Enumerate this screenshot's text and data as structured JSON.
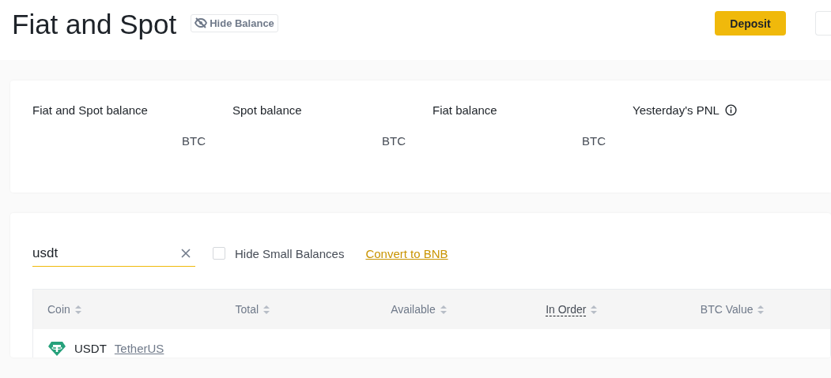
{
  "title": "Fiat and Spot",
  "hide_balance_button": "Hide Balance",
  "deposit_button": "Deposit",
  "balances": [
    {
      "label": "Fiat and Spot balance",
      "unit": "BTC",
      "info": false
    },
    {
      "label": "Spot balance",
      "unit": "BTC",
      "info": false
    },
    {
      "label": "Fiat balance",
      "unit": "BTC",
      "info": false
    },
    {
      "label": "Yesterday's PNL",
      "info": true
    }
  ],
  "search": {
    "value": "usdt"
  },
  "hide_small_balances": {
    "label": "Hide Small Balances",
    "checked": false
  },
  "convert_link": "Convert to BNB",
  "table": {
    "columns": [
      {
        "label": "Coin",
        "tooltip": false
      },
      {
        "label": "Total",
        "tooltip": false
      },
      {
        "label": "Available",
        "tooltip": false
      },
      {
        "label": "In Order",
        "tooltip": true
      },
      {
        "label": "BTC Value",
        "tooltip": false
      }
    ],
    "rows": [
      {
        "coin": "USDT",
        "name": "TetherUS"
      }
    ]
  }
}
